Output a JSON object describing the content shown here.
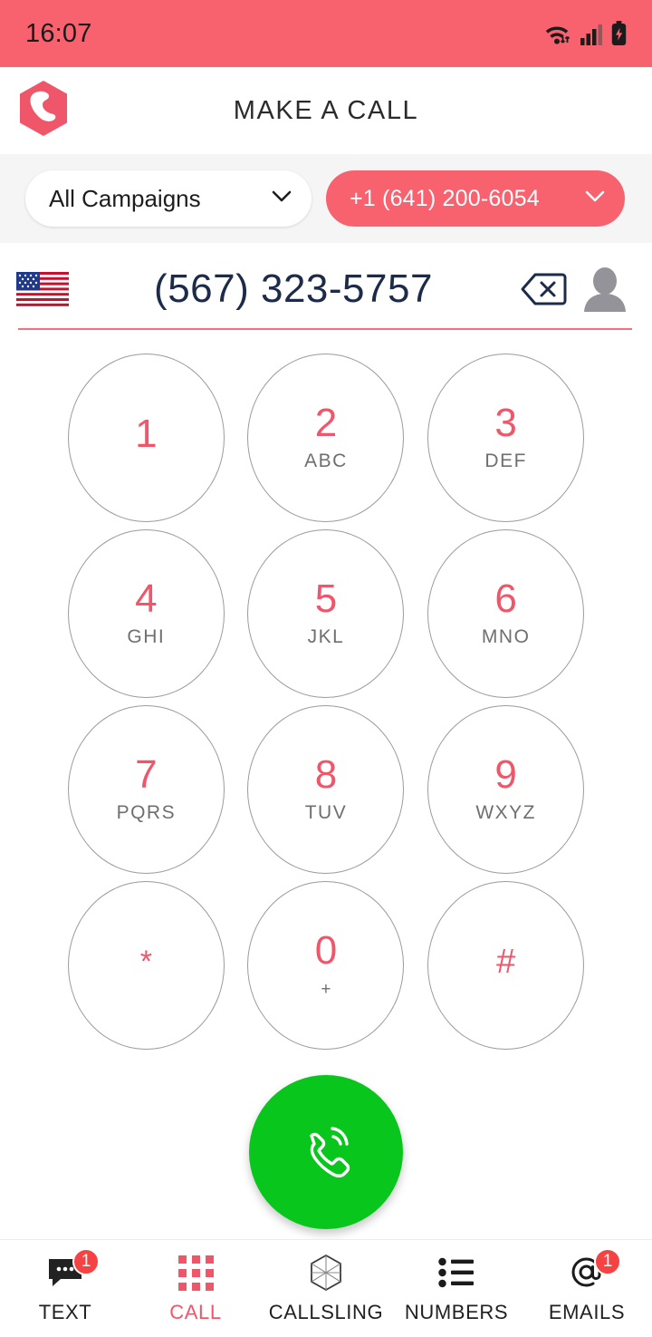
{
  "status_bar": {
    "time": "16:07",
    "icons": [
      "wifi-icon",
      "cellular-signal-icon",
      "battery-charging-icon"
    ]
  },
  "header": {
    "logo": "callsling-hexagon-logo",
    "title": "MAKE A CALL"
  },
  "selector_bar": {
    "campaign": {
      "label": "All Campaigns",
      "icon": "chevron-down-icon"
    },
    "caller_number": {
      "label": "+1 (641) 200-6054",
      "icon": "chevron-down-icon",
      "color": "#f8616e"
    }
  },
  "dial_display": {
    "country_flag": "us-flag-icon",
    "number": "(567) 323-5757",
    "number_color": "#1c2b4a",
    "backspace_icon": "backspace-icon",
    "contact_icon": "contact-person-icon",
    "underline_color": "#f3707c"
  },
  "keypad": {
    "keys": [
      {
        "digit": "1",
        "letters": ""
      },
      {
        "digit": "2",
        "letters": "ABC"
      },
      {
        "digit": "3",
        "letters": "DEF"
      },
      {
        "digit": "4",
        "letters": "GHI"
      },
      {
        "digit": "5",
        "letters": "JKL"
      },
      {
        "digit": "6",
        "letters": "MNO"
      },
      {
        "digit": "7",
        "letters": "PQRS"
      },
      {
        "digit": "8",
        "letters": "TUV"
      },
      {
        "digit": "9",
        "letters": "WXYZ"
      },
      {
        "digit": "*",
        "letters": ""
      },
      {
        "digit": "0",
        "letters": "+"
      },
      {
        "digit": "#",
        "letters": ""
      }
    ],
    "digit_color": "#f0566a",
    "letter_color": "#6f6f6f"
  },
  "call_action": {
    "icon": "phone-call-icon",
    "color": "#09c61c"
  },
  "bottom_nav": {
    "active": "CALL",
    "items": [
      {
        "label": "TEXT",
        "icon": "chat-bubble-icon",
        "badge": "1"
      },
      {
        "label": "CALL",
        "icon": "dialpad-grid-icon",
        "badge": ""
      },
      {
        "label": "CALLSLING",
        "icon": "hexagon-mesh-icon",
        "badge": ""
      },
      {
        "label": "NUMBERS",
        "icon": "bullet-list-icon",
        "badge": ""
      },
      {
        "label": "EMAILS",
        "icon": "at-sign-icon",
        "badge": "1"
      }
    ]
  }
}
